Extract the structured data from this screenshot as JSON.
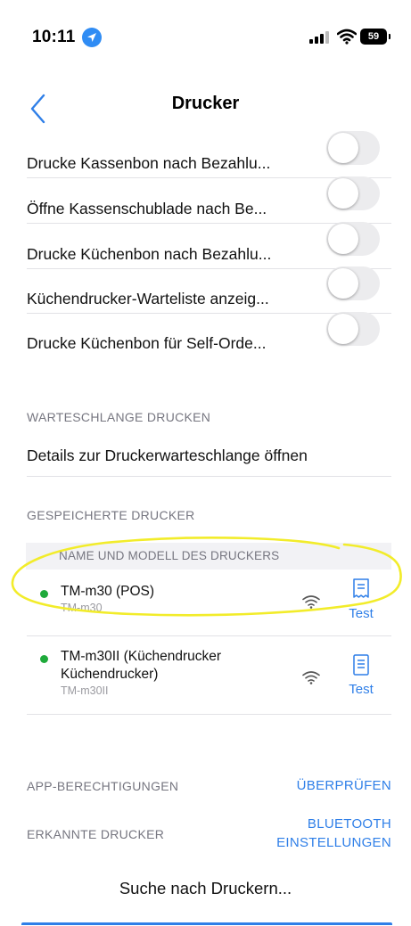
{
  "status_bar": {
    "time": "10:11",
    "battery": "59"
  },
  "nav": {
    "title": "Drucker"
  },
  "settings_rows": [
    {
      "label": "Drucke Kassenbon nach Bezahlu...",
      "enabled": false
    },
    {
      "label": "Öffne Kassenschublade nach Be...",
      "enabled": false
    },
    {
      "label": "Drucke Küchenbon nach Bezahlu...",
      "enabled": false
    },
    {
      "label": "Küchendrucker-Warteliste anzeig...",
      "enabled": false
    },
    {
      "label": "Drucke Küchenbon für Self-Orde...",
      "enabled": false
    }
  ],
  "queue_section": {
    "header": "WARTESCHLANGE DRUCKEN",
    "details_link": "Details zur Druckerwarteschlange öffnen"
  },
  "saved_printers": {
    "header": "GESPEICHERTE DRUCKER",
    "column_header": "NAME UND MODELL DES DRUCKERS",
    "printers": [
      {
        "name": "TM-m30 (POS)",
        "name_line2": "",
        "model": "TM-m30",
        "status": "online",
        "test_label": "Test"
      },
      {
        "name": "TM-m30II (Küchendrucker",
        "name_line2": "Küchendrucker)",
        "model": "TM-m30II",
        "status": "online",
        "test_label": "Test"
      }
    ]
  },
  "permissions": {
    "label": "APP-BERECHTIGUNGEN",
    "action": "ÜBERPRÜFEN"
  },
  "detected": {
    "label": "ERKANNTE DRUCKER",
    "action_line1": "BLUETOOTH",
    "action_line2": "EINSTELLUNGEN"
  },
  "search_button": "Suche nach Druckern...",
  "colors": {
    "accent": "#2f7fe8",
    "online": "#1faa3b",
    "annotation": "#f2ec2a"
  }
}
